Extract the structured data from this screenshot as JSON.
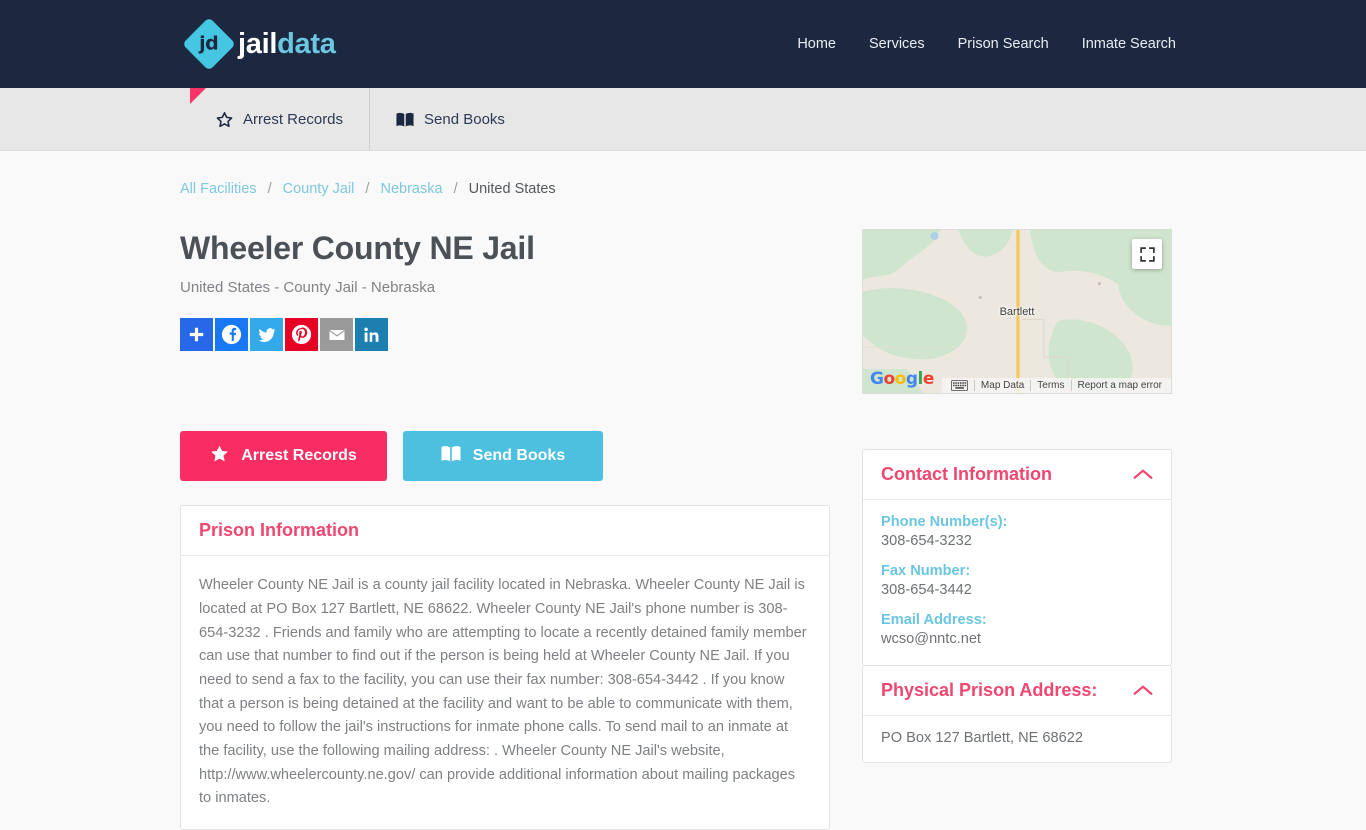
{
  "header": {
    "brand_primary": "jail",
    "brand_secondary": "data",
    "logo_text": "jd",
    "nav": [
      {
        "label": "Home"
      },
      {
        "label": "Services"
      },
      {
        "label": "Prison Search"
      },
      {
        "label": "Inmate Search"
      }
    ]
  },
  "tabbar": {
    "tabs": [
      {
        "label": "Arrest Records",
        "icon": "star-icon",
        "active": true
      },
      {
        "label": "Send Books",
        "icon": "book-icon",
        "active": false
      }
    ]
  },
  "breadcrumb": {
    "items": [
      {
        "label": "All Facilities",
        "link": true
      },
      {
        "label": "County Jail",
        "link": true
      },
      {
        "label": "Nebraska",
        "link": true
      },
      {
        "label": "United States",
        "link": false
      }
    ],
    "separator": "/"
  },
  "page": {
    "title": "Wheeler County NE Jail",
    "subtitle": "United States - County Jail - Nebraska"
  },
  "share": {
    "buttons": [
      {
        "name": "addthis-share-button",
        "icon": "plus-icon",
        "label": "Share"
      },
      {
        "name": "facebook-share-button",
        "icon": "facebook-icon",
        "label": "Facebook"
      },
      {
        "name": "twitter-share-button",
        "icon": "twitter-icon",
        "label": "Twitter"
      },
      {
        "name": "pinterest-share-button",
        "icon": "pinterest-icon",
        "label": "Pinterest"
      },
      {
        "name": "email-share-button",
        "icon": "email-icon",
        "label": "Email"
      },
      {
        "name": "linkedin-share-button",
        "icon": "linkedin-icon",
        "label": "LinkedIn"
      }
    ]
  },
  "actions": {
    "arrest_records": "Arrest Records",
    "send_books": "Send Books"
  },
  "prison_information": {
    "heading": "Prison Information",
    "body": "Wheeler County NE Jail is a county jail facility located in Nebraska. Wheeler County NE Jail is located at PO Box 127 Bartlett, NE 68622. Wheeler County NE Jail's phone number is 308-654-3232 . Friends and family who are attempting to locate a recently detained family member can use that number to find out if the person is being held at Wheeler County NE Jail. If you need to send a fax to the facility, you can use their fax number: 308-654-3442 . If you know that a person is being detained at the facility and want to be able to communicate with them, you need to follow the jail's instructions for inmate phone calls. To send mail to an inmate at the facility, use the following mailing address: . Wheeler County NE Jail's website, http://www.wheelercounty.ne.gov/ can provide additional information about mailing packages to inmates."
  },
  "contact": {
    "heading": "Contact Information",
    "fields": [
      {
        "label": "Phone Number(s):",
        "value": "308-654-3232"
      },
      {
        "label": "Fax Number:",
        "value": "308-654-3442"
      },
      {
        "label": "Email Address:",
        "value": "wcso@nntc.net"
      }
    ]
  },
  "address": {
    "heading": "Physical Prison Address:",
    "value": "PO Box 127 Bartlett, NE 68622"
  },
  "map": {
    "place_label": "Bartlett",
    "provider": "Google",
    "attribution": [
      {
        "label": "Map Data"
      },
      {
        "label": "Terms"
      },
      {
        "label": "Report a map error"
      }
    ],
    "fullscreen_label": "Toggle fullscreen view"
  },
  "colors": {
    "header_bg": "#1b2840",
    "accent_pink": "#fa2d63",
    "accent_cyan": "#4cc0de",
    "heading_pink": "#ef4770",
    "label_blue": "#6cc6e2",
    "page_bg": "#f9f9f9"
  }
}
